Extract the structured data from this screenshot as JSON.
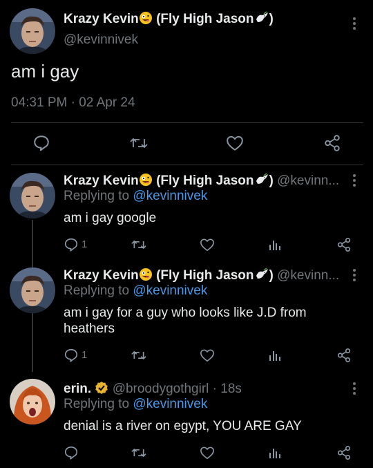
{
  "main_tweet": {
    "display_name": "Krazy Kevin",
    "name_suffix": "(Fly High Jason",
    "name_close": ")",
    "handle": "@kevinnivek",
    "text": "am i gay",
    "timestamp": "04:31 PM · 02 Apr 24"
  },
  "replies": [
    {
      "display_name": "Krazy Kevin",
      "name_suffix": "(Fly High Jason",
      "name_close": ")",
      "handle": "@kevinn...",
      "replying_label": "Replying to",
      "replying_handle": "@kevinnivek",
      "text": "am i gay google",
      "reply_count": "1"
    },
    {
      "display_name": "Krazy Kevin",
      "name_suffix": "(Fly High Jason",
      "name_close": ")",
      "handle": "@kevinn...",
      "replying_label": "Replying to",
      "replying_handle": "@kevinnivek",
      "text": "am i gay for a guy who looks like J.D from heathers",
      "reply_count": "1"
    },
    {
      "display_name": "erin.",
      "handle": "@broodygothgirl · 18s",
      "replying_label": "Replying to",
      "replying_handle": "@kevinnivek",
      "text": "denial is a river on egypt, YOU ARE GAY"
    }
  ],
  "icons": {
    "reply": "reply-icon",
    "retweet": "retweet-icon",
    "like": "heart-icon",
    "views": "views-icon",
    "share": "share-icon",
    "menu": "more-vertical-icon",
    "verified": "verified-badge-icon",
    "emoji_face": "zany-face-emoji",
    "emoji_dove": "dove-emoji"
  },
  "colors": {
    "background": "#000000",
    "text": "#e7e9ea",
    "muted": "#71767b",
    "link": "#4a99e9",
    "verified": "#e9b32c"
  }
}
